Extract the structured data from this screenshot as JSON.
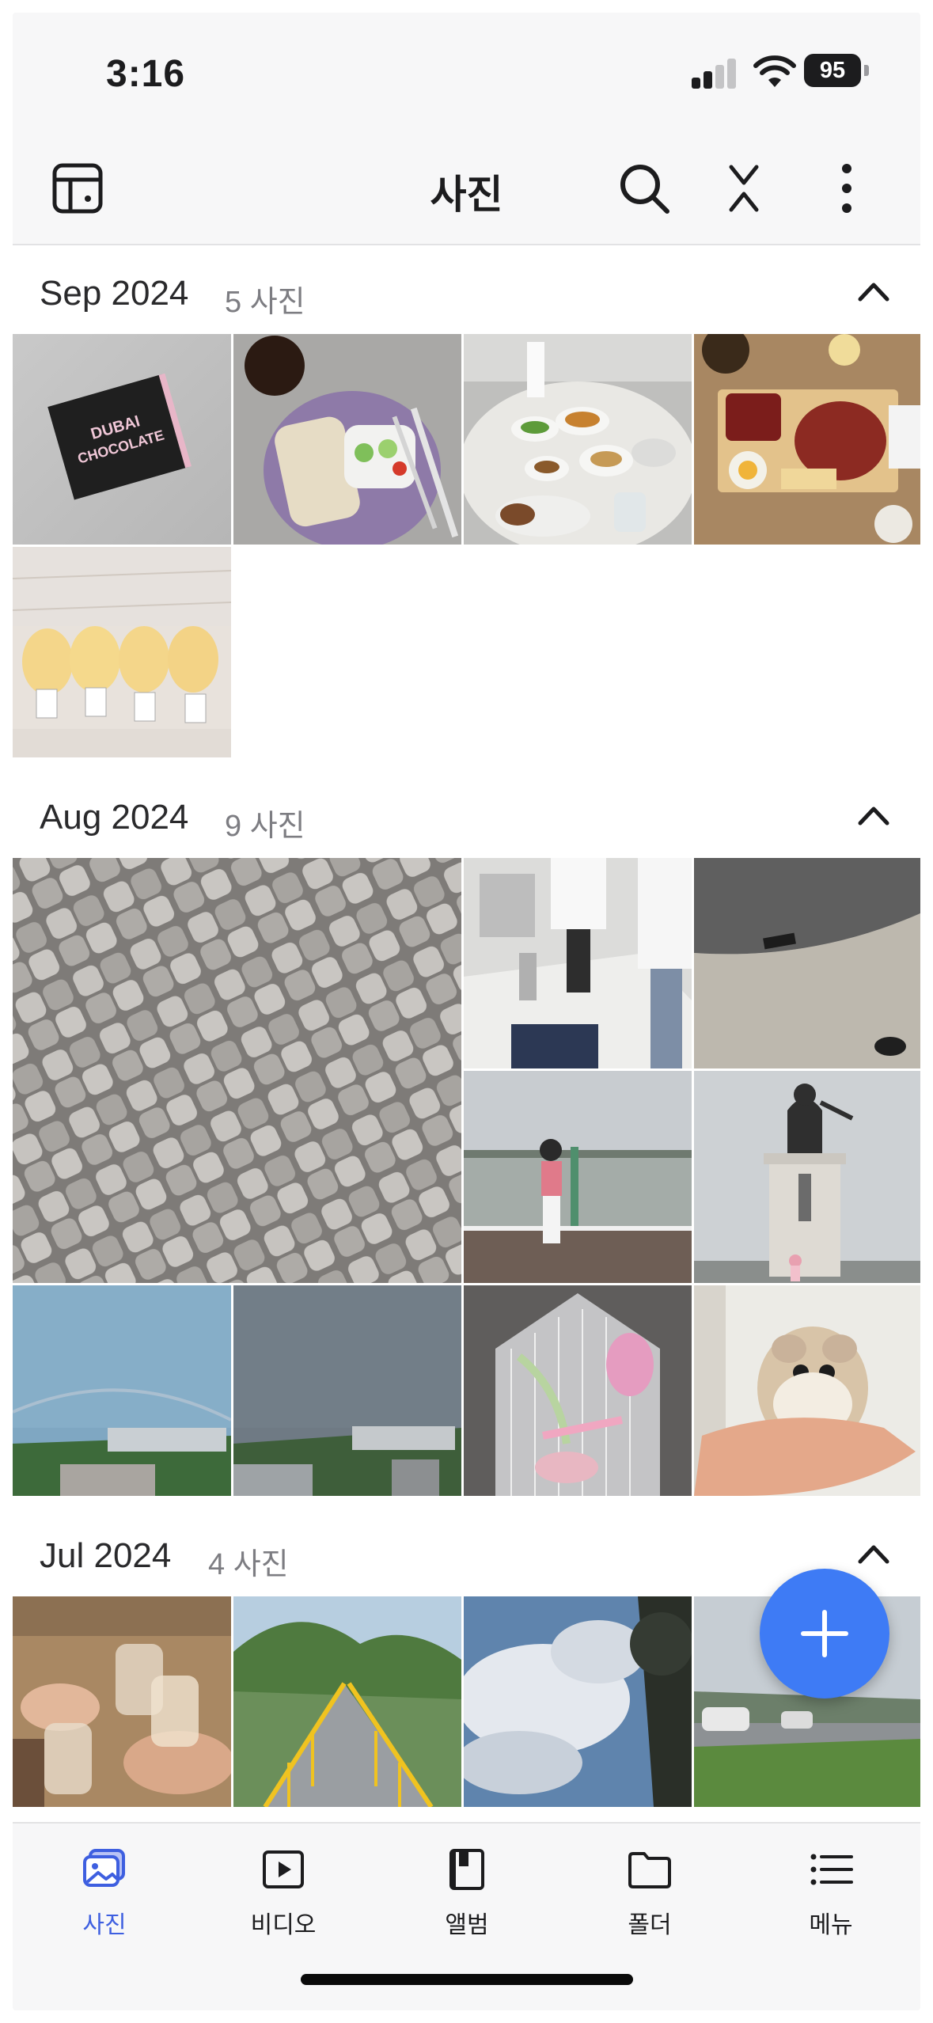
{
  "status_bar": {
    "time": "3:16",
    "battery": "95"
  },
  "header": {
    "title": "사진"
  },
  "sections": [
    {
      "month": "Sep 2024",
      "count": "5 사진"
    },
    {
      "month": "Aug 2024",
      "count": "9 사진"
    },
    {
      "month": "Jul 2024",
      "count": "4 사진"
    }
  ],
  "photos": {
    "sep_chocolate_text_1": "DUBAI",
    "sep_chocolate_text_2": "CHOCOLATE"
  },
  "nav": {
    "items": [
      {
        "label": "사진",
        "icon": "photos-icon"
      },
      {
        "label": "비디오",
        "icon": "video-icon"
      },
      {
        "label": "앨범",
        "icon": "album-icon"
      },
      {
        "label": "폴더",
        "icon": "folder-icon"
      },
      {
        "label": "메뉴",
        "icon": "menu-list-icon"
      }
    ],
    "active_color": "#3e5fe0"
  },
  "accent_color": "#3e7bf5"
}
